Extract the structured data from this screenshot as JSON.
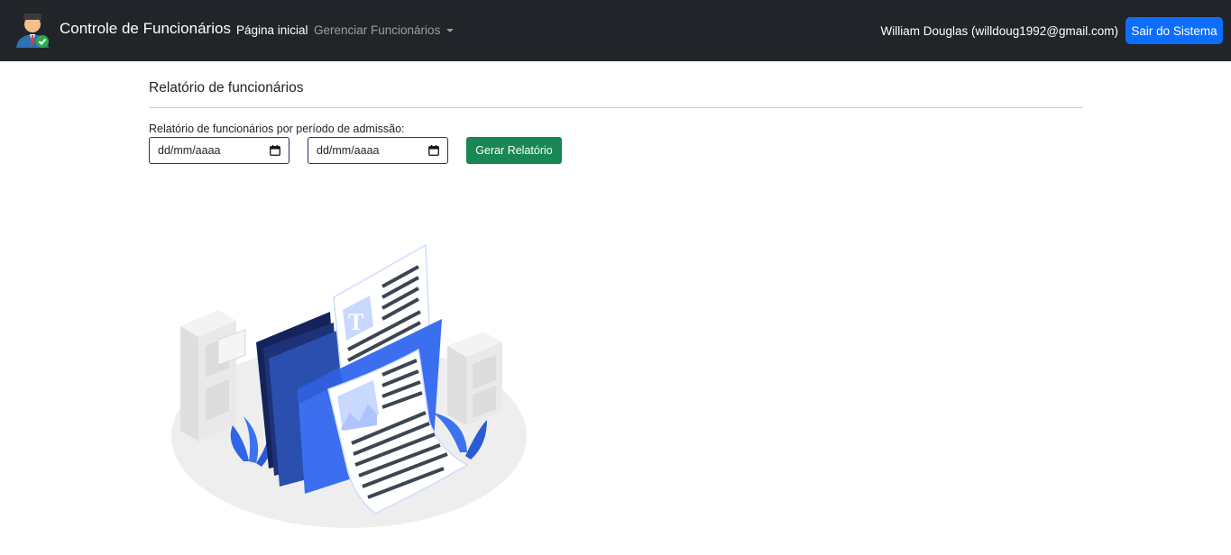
{
  "navbar": {
    "brand_title": "Controle de Funcionários",
    "home_link": "Página inicial",
    "manage_link": "Gerenciar Funcionários",
    "user": "William Douglas (willdoug1992@gmail.com)",
    "logout_label": "Sair do Sistema",
    "brand_icon": "employee-check-icon"
  },
  "report": {
    "title": "Relatório de funcionários",
    "filter_label": "Relatório de funcionários por período de admissão:",
    "start_date_placeholder": "dd/mm/aaaa",
    "end_date_placeholder": "dd/mm/aaaa",
    "generate_label": "Gerar Relatório"
  },
  "colors": {
    "navbar_bg": "#212529",
    "primary": "#0d6efd",
    "success": "#198754",
    "illustration_blue": "#3b6ff0"
  }
}
